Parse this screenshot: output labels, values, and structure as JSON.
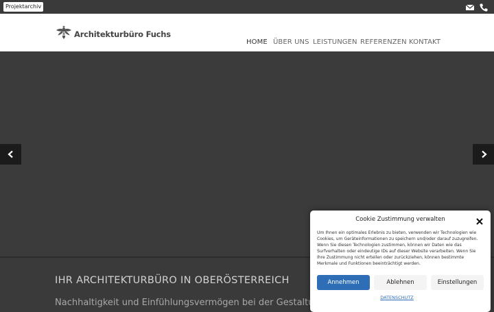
{
  "topbar": {
    "archive_label": "Projektarchiv",
    "icons": [
      "mail-icon",
      "phone-icon"
    ]
  },
  "header": {
    "logo_text": "Architekturbüro Fuchs",
    "nav": [
      {
        "label": "HOME",
        "active": true
      },
      {
        "label": "ÜBER UNS",
        "active": false
      },
      {
        "label": "LEISTUNGEN",
        "active": false
      },
      {
        "label": "REFERENZEN",
        "active": false
      },
      {
        "label": "KONTAKT",
        "active": false
      }
    ]
  },
  "slider": {
    "prev_icon": "chevron-left-icon",
    "next_icon": "chevron-right-icon"
  },
  "hero": {
    "title": "IHR ARCHITEKTURBÜRO IN OBERÖSTERREICH",
    "subtitle": "Nachhaltigkeit und Einfühlungsvermögen bei der Gestaltung von Lebensräumen"
  },
  "cookie": {
    "title": "Cookie Zustimmung verwalten",
    "text": "Um Ihnen ein optimales Erlebnis zu bieten, verwenden wir Technologien wie Cookies, um Geräteinformationen zu speichern und/oder darauf zuzugreifen. Wenn Sie diesen Technologien zustimmen, können wir Daten wie das Surfverhalten oder eindeutige IDs auf dieser Website verarbeiten. Wenn Sie Ihre Zustimmung nicht erteilen oder zurückziehen, können bestimmte Merkmale und Funktionen beeinträchtigt werden.",
    "accept_label": "Annehmen",
    "deny_label": "Ablehnen",
    "settings_label": "Einstellungen",
    "privacy_link": "DATENSCHUTZ"
  },
  "colors": {
    "accent": "#2d6eb7",
    "dark_bg": "#3a3a3a",
    "header_bg": "#ffffff"
  }
}
